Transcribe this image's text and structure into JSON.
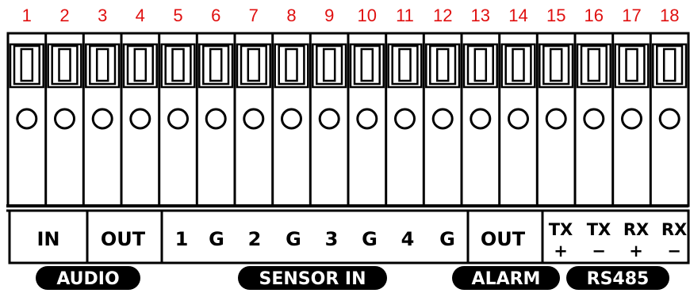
{
  "pins": [
    "1",
    "2",
    "3",
    "4",
    "5",
    "6",
    "7",
    "8",
    "9",
    "10",
    "11",
    "12",
    "13",
    "14",
    "15",
    "16",
    "17",
    "18"
  ],
  "terminal_labels": [
    {
      "text": "IN"
    },
    {
      "text": "OUT"
    },
    {
      "text": "1"
    },
    {
      "text": "G"
    },
    {
      "text": "2"
    },
    {
      "text": "G"
    },
    {
      "text": "3"
    },
    {
      "text": "G"
    },
    {
      "text": "4"
    },
    {
      "text": "G"
    },
    {
      "text": "OUT"
    },
    {
      "text": "TX",
      "sub": "+"
    },
    {
      "text": "TX",
      "sub": "−"
    },
    {
      "text": "RX",
      "sub": "+"
    },
    {
      "text": "RX",
      "sub": "−"
    }
  ],
  "groups": [
    {
      "text": "AUDIO"
    },
    {
      "text": "SENSOR IN"
    },
    {
      "text": "ALARM"
    },
    {
      "text": "RS485"
    }
  ],
  "colors": {
    "pin_number": "#e01010",
    "line": "#000000",
    "group_fill": "#000000",
    "group_text": "#ffffff"
  }
}
